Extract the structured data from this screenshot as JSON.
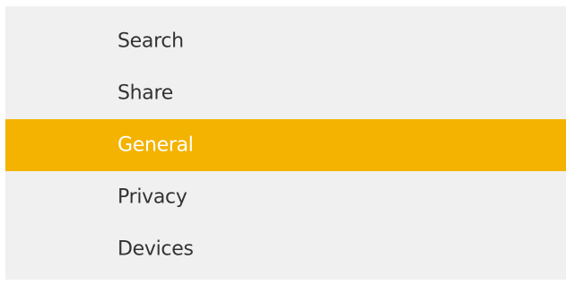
{
  "menu": {
    "accent_color": "#f3b300",
    "selected_index": 2,
    "items": [
      {
        "label": "Search"
      },
      {
        "label": "Share"
      },
      {
        "label": "General"
      },
      {
        "label": "Privacy"
      },
      {
        "label": "Devices"
      }
    ]
  }
}
